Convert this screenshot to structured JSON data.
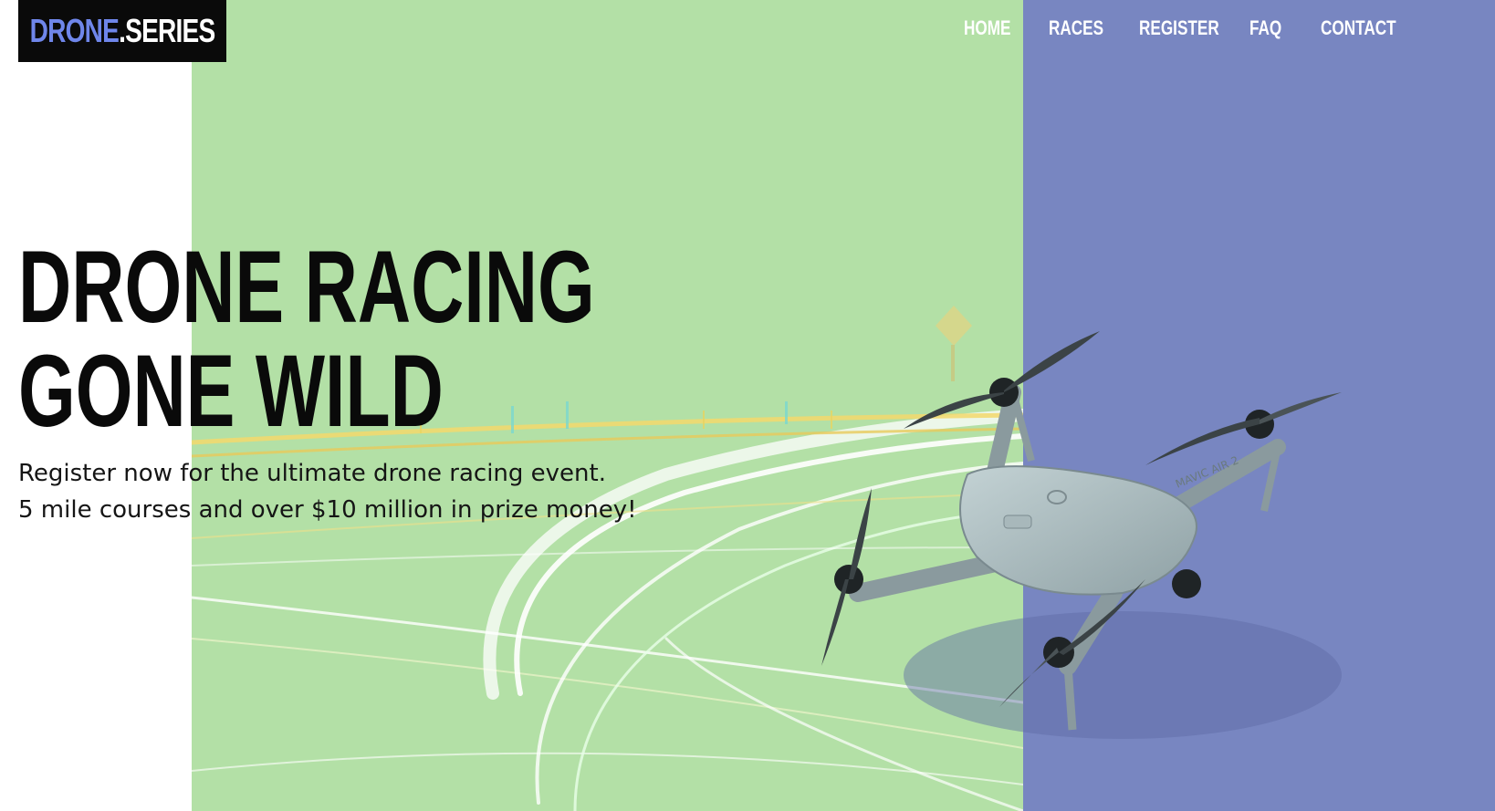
{
  "logo": {
    "part_a": "DRONE",
    "part_b": ".SERIES"
  },
  "nav": {
    "items": [
      {
        "label": "HOME"
      },
      {
        "label": "RACES"
      },
      {
        "label": "REGISTER"
      },
      {
        "label": "FAQ"
      },
      {
        "label": "CONTACT"
      }
    ]
  },
  "hero": {
    "title_line1": "DRONE RACING",
    "title_line2": "GONE WILD",
    "subtitle_line1": "Register now for the ultimate drone racing event.",
    "subtitle_line2": "5 mile courses and over $10 million in prize money!"
  },
  "drone_label": "MAVIC AIR 2",
  "colors": {
    "green_panel": "#b3e0a6",
    "purple_panel": "#7886c1",
    "logo_accent": "#6f86ea",
    "text_dark": "#0a0a0a"
  }
}
